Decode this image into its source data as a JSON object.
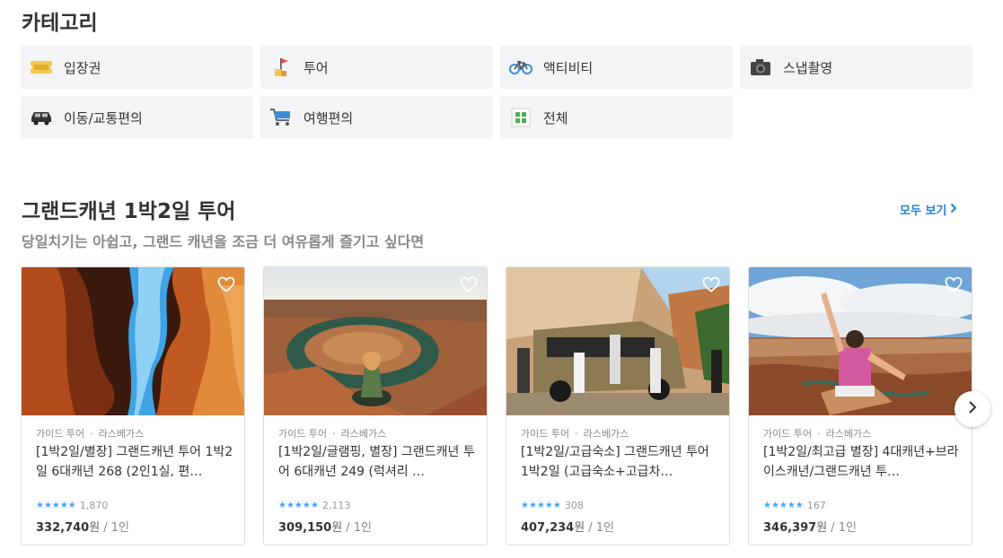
{
  "categories": {
    "title": "카테고리",
    "items": [
      {
        "label": "입장권",
        "icon": "ticket-icon"
      },
      {
        "label": "투어",
        "icon": "flag-icon"
      },
      {
        "label": "액티비티",
        "icon": "bicycle-icon"
      },
      {
        "label": "스냅촬영",
        "icon": "camera-icon"
      },
      {
        "label": "이동/교통편의",
        "icon": "car-icon"
      },
      {
        "label": "여행편의",
        "icon": "cart-icon"
      },
      {
        "label": "전체",
        "icon": "grid-icon"
      }
    ]
  },
  "tour_section": {
    "title": "그랜드캐년 1박2일 투어",
    "subtitle": "당일치기는 아쉽고, 그랜드 캐년을 조금 더 여유롭게 즐기고 싶다면",
    "see_all": "모두 보기",
    "cards": [
      {
        "category": "가이드 투어",
        "city": "라스베가스",
        "title": "[1박2일/별장] 그랜드캐년 투어 1박2일 6대캐년 268 (2인1실, 편…",
        "stars": "★★★★★",
        "reviews": "1,870",
        "price": "332,740",
        "currency": "원",
        "per": "/ 1인",
        "image": "antelope-canyon"
      },
      {
        "category": "가이드 투어",
        "city": "라스베가스",
        "title": "[1박2일/글램핑, 별장] 그랜드캐년 투어 6대캐년 249 (럭셔리 …",
        "stars": "★★★★★",
        "reviews": "2,113",
        "price": "309,150",
        "currency": "원",
        "per": "/ 1인",
        "image": "horseshoe-bend"
      },
      {
        "category": "가이드 투어",
        "city": "라스베가스",
        "title": "[1박2일/고급숙소] 그랜드캐년 투어 1박2일 (고급숙소+고급차…",
        "stars": "★★★★★",
        "reviews": "308",
        "price": "407,234",
        "currency": "원",
        "per": "/ 1인",
        "image": "van-group"
      },
      {
        "category": "가이드 투어",
        "city": "라스베가스",
        "title": "[1박2일/최고급 별장] 4대캐년+브라이스캐년/그랜드캐년 투…",
        "stars": "★★★★★",
        "reviews": "167",
        "price": "346,397",
        "currency": "원",
        "per": "/ 1인",
        "image": "canyon-woman"
      }
    ]
  },
  "meta_separator": "·",
  "colors": {
    "accent": "#1f7fd9",
    "star": "#47a3f5",
    "tile_bg": "#f3f4f5"
  }
}
